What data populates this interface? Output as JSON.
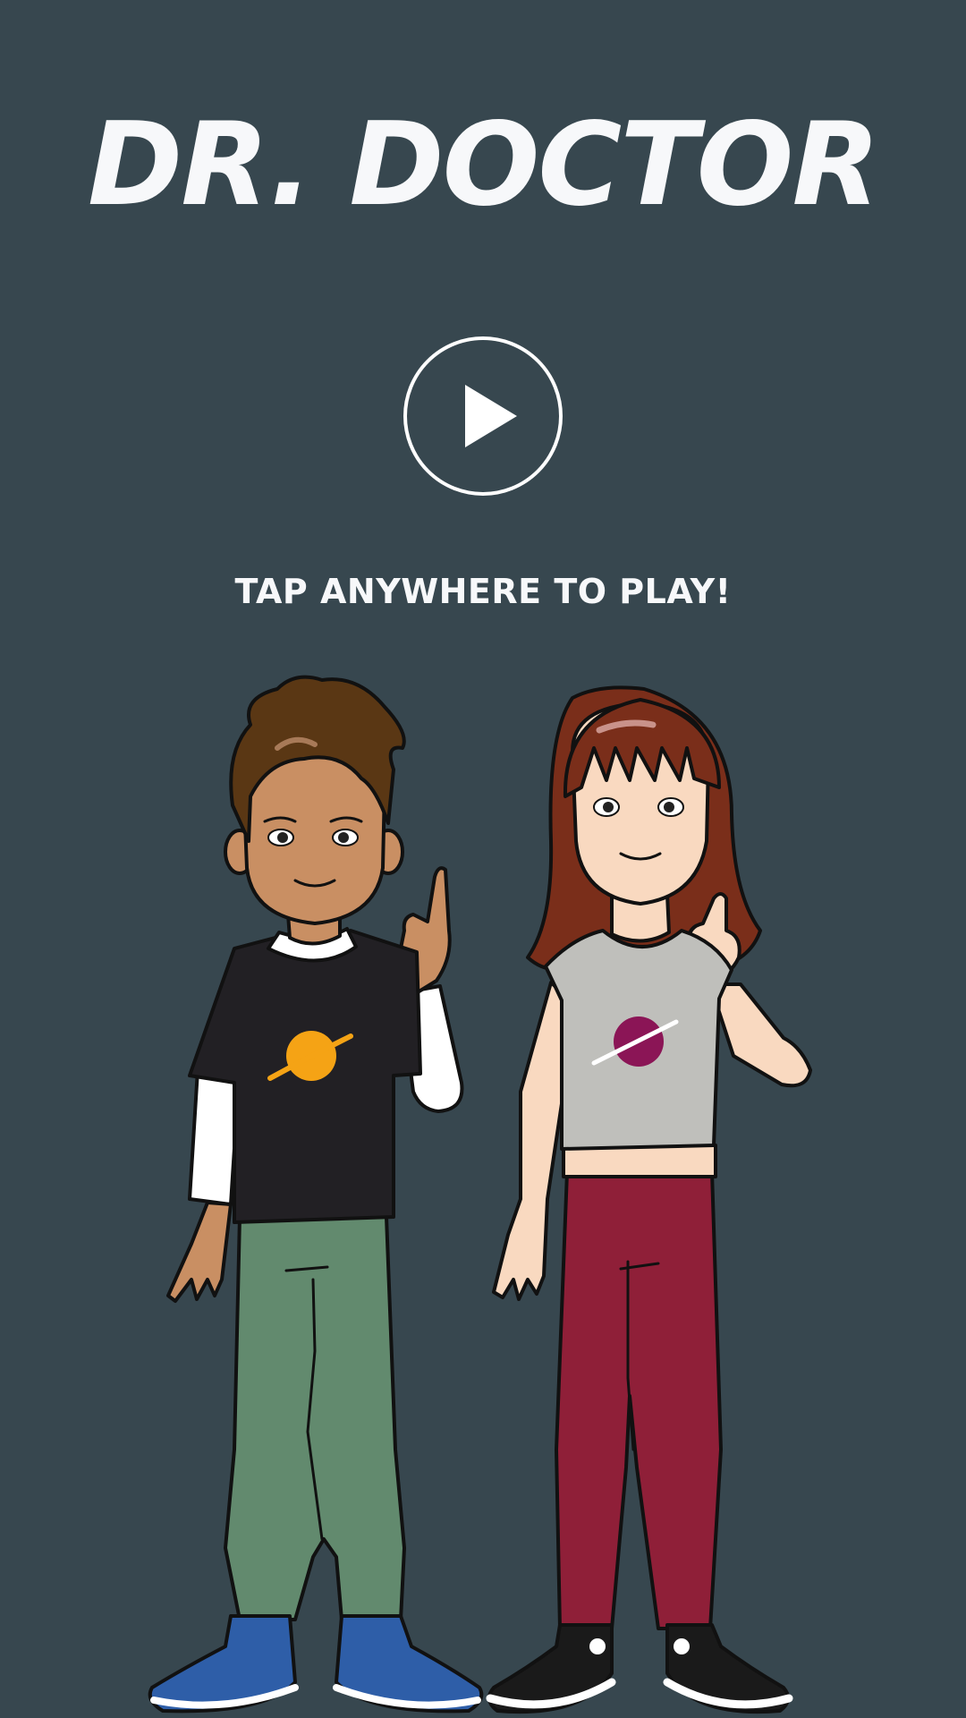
{
  "title": "DR. DOCTOR",
  "play_button": {
    "icon": "play-icon"
  },
  "prompt": "TAP ANYWHERE TO PLAY!",
  "colors": {
    "background": "#37474f",
    "text": "#f7f8fa"
  },
  "characters": [
    {
      "id": "boy",
      "shirt_color": "#222024",
      "pants_color": "#628a6e",
      "shoe_color": "#2e5ea8",
      "logo_color": "#f5a315"
    },
    {
      "id": "girl",
      "shirt_color": "#bfbfbb",
      "pants_color": "#8f1f38",
      "shoe_color": "#1a1a1a",
      "logo_color": "#8b1556"
    }
  ]
}
